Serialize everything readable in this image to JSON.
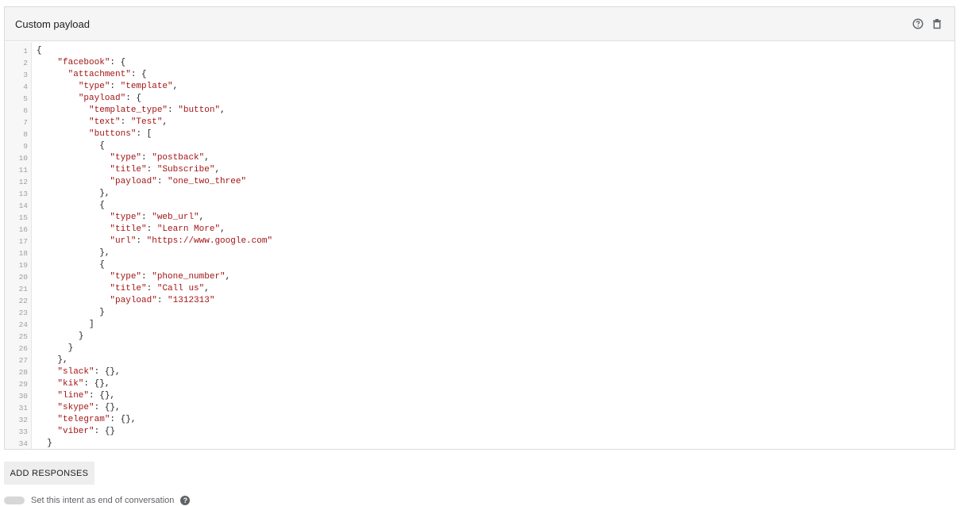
{
  "card": {
    "title": "Custom payload",
    "help_icon": "help-circle-icon",
    "delete_icon": "trash-icon"
  },
  "editor": {
    "lines": [
      "{",
      "    \"facebook\": {",
      "      \"attachment\": {",
      "        \"type\": \"template\",",
      "        \"payload\": {",
      "          \"template_type\": \"button\",",
      "          \"text\": \"Test\",",
      "          \"buttons\": [",
      "            {",
      "              \"type\": \"postback\",",
      "              \"title\": \"Subscribe\",",
      "              \"payload\": \"one_two_three\"",
      "            },",
      "            {",
      "              \"type\": \"web_url\",",
      "              \"title\": \"Learn More\",",
      "              \"url\": \"https://www.google.com\"",
      "            },",
      "            {",
      "              \"type\": \"phone_number\",",
      "              \"title\": \"Call us\",",
      "              \"payload\": \"1312313\"",
      "            }",
      "          ]",
      "        }",
      "      }",
      "    },",
      "    \"slack\": {},",
      "    \"kik\": {},",
      "    \"line\": {},",
      "    \"skype\": {},",
      "    \"telegram\": {},",
      "    \"viber\": {}",
      "  }"
    ]
  },
  "actions": {
    "add_responses_label": "ADD RESPONSES"
  },
  "footer": {
    "end_conversation_label": "Set this intent as end of conversation"
  },
  "colors": {
    "string": "#a31515",
    "header_bg": "#f5f5f5",
    "button_bg": "#eeeeee"
  }
}
